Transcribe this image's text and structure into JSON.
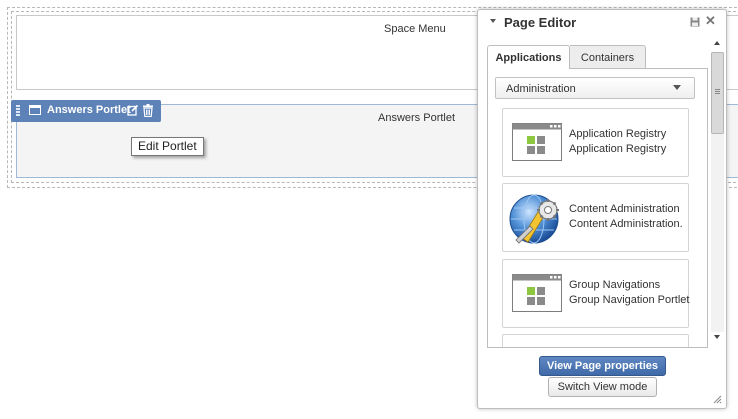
{
  "page": {
    "space_menu_title": "Space Menu",
    "answers_portlet_title": "Answers Portlet",
    "portlet_toolbar": {
      "label": "Answers Portlet"
    },
    "tooltip": "Edit Portlet"
  },
  "page_editor": {
    "title": "Page Editor",
    "tabs": [
      {
        "label": "Applications",
        "active": true
      },
      {
        "label": "Containers",
        "active": false
      }
    ],
    "category_select": {
      "value": "Administration"
    },
    "applications": [
      {
        "name": "Application Registry",
        "description": "Application Registry",
        "icon": "application-window-icon"
      },
      {
        "name": "Content Administration",
        "description": "Content Administration.",
        "icon": "globe-gear-icon"
      },
      {
        "name": "Group Navigations",
        "description": "Group Navigation Portlet",
        "icon": "application-window-icon"
      },
      {
        "name": "",
        "description": "",
        "icon": "application-window-icon"
      }
    ],
    "buttons": {
      "view_page_properties": "View Page properties",
      "switch_view_mode": "Switch View mode"
    }
  },
  "colors": {
    "toolbar_blue": "#5d82b7",
    "primary_button": "#4a74b3",
    "icon_green": "#8dc63f"
  }
}
